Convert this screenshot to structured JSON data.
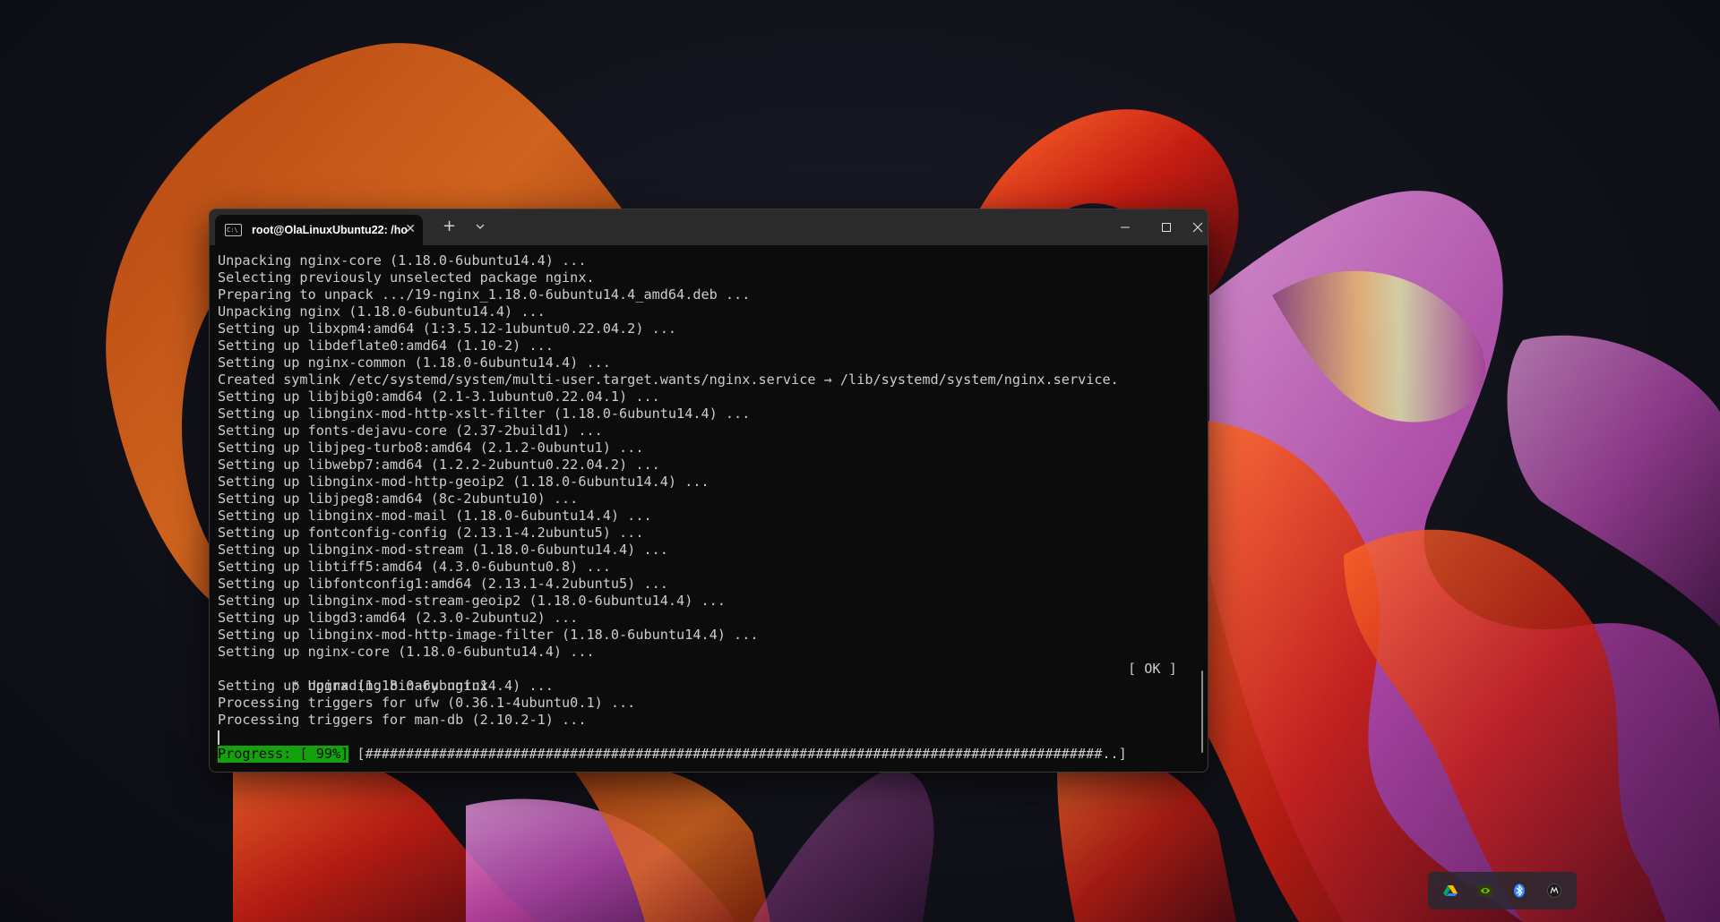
{
  "window": {
    "tab_title": "root@OlaLinuxUbuntu22: /ho",
    "tab_icon": "C:\\",
    "tab_close_glyph": "✕",
    "new_tab_glyph": "+"
  },
  "terminal": {
    "lines": [
      "Unpacking nginx-core (1.18.0-6ubuntu14.4) ...",
      "Selecting previously unselected package nginx.",
      "Preparing to unpack .../19-nginx_1.18.0-6ubuntu14.4_amd64.deb ...",
      "Unpacking nginx (1.18.0-6ubuntu14.4) ...",
      "Setting up libxpm4:amd64 (1:3.5.12-1ubuntu0.22.04.2) ...",
      "Setting up libdeflate0:amd64 (1.10-2) ...",
      "Setting up nginx-common (1.18.0-6ubuntu14.4) ...",
      "Created symlink /etc/systemd/system/multi-user.target.wants/nginx.service → /lib/systemd/system/nginx.service.",
      "Setting up libjbig0:amd64 (2.1-3.1ubuntu0.22.04.1) ...",
      "Setting up libnginx-mod-http-xslt-filter (1.18.0-6ubuntu14.4) ...",
      "Setting up fonts-dejavu-core (2.37-2build1) ...",
      "Setting up libjpeg-turbo8:amd64 (2.1.2-0ubuntu1) ...",
      "Setting up libwebp7:amd64 (1.2.2-2ubuntu0.22.04.2) ...",
      "Setting up libnginx-mod-http-geoip2 (1.18.0-6ubuntu14.4) ...",
      "Setting up libjpeg8:amd64 (8c-2ubuntu10) ...",
      "Setting up libnginx-mod-mail (1.18.0-6ubuntu14.4) ...",
      "Setting up fontconfig-config (2.13.1-4.2ubuntu5) ...",
      "Setting up libnginx-mod-stream (1.18.0-6ubuntu14.4) ...",
      "Setting up libtiff5:amd64 (4.3.0-6ubuntu0.8) ...",
      "Setting up libfontconfig1:amd64 (2.13.1-4.2ubuntu5) ...",
      "Setting up libnginx-mod-stream-geoip2 (1.18.0-6ubuntu14.4) ...",
      "Setting up libgd3:amd64 (2.3.0-2ubuntu2) ...",
      "Setting up libnginx-mod-http-image-filter (1.18.0-6ubuntu14.4) ...",
      "Setting up nginx-core (1.18.0-6ubuntu14.4) ..."
    ],
    "upgrading_line": " * Upgrading binary nginx",
    "ok_status": "[ OK ]",
    "lines_after": [
      "Setting up nginx (1.18.0-6ubuntu14.4) ...",
      "Processing triggers for ufw (0.36.1-4ubuntu0.1) ...",
      "Processing triggers for man-db (2.10.2-1) ..."
    ],
    "progress_label": "Progress: [ 99%]",
    "progress_percent": 99,
    "progress_bar": "[##########################################################################################..]"
  },
  "tray": {
    "icons": [
      "google-drive-icon",
      "nvidia-icon",
      "bluetooth-icon",
      "app-icon"
    ],
    "colors": {
      "bluetooth": "#2f8cff",
      "nvidia": "#76b900",
      "terminal_green": "#13a10e"
    }
  }
}
